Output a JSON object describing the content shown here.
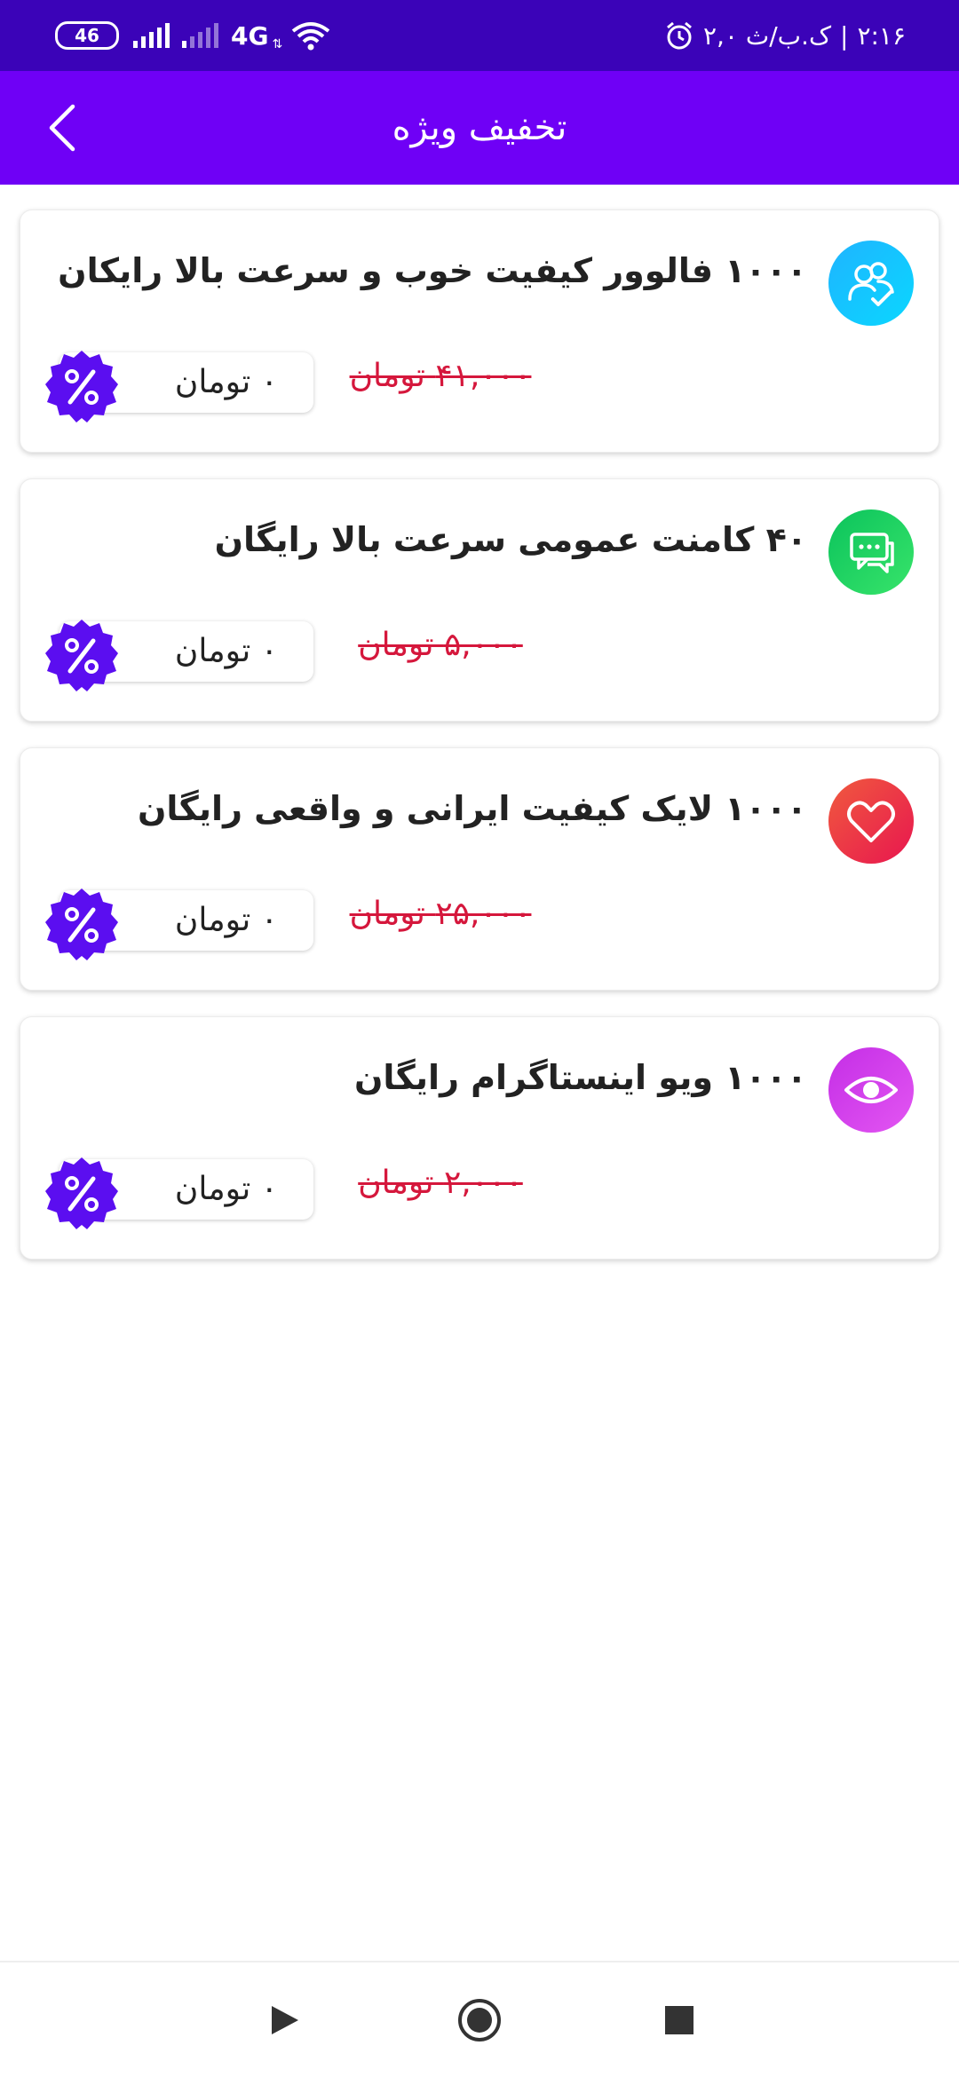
{
  "status_bar": {
    "time": "۲:۱۶",
    "date": "ک.ب/ث ۲,۰",
    "battery": "46",
    "network": "4G"
  },
  "app_bar": {
    "title": "تخفیف ویژه",
    "back_icon": "chevron-left-icon"
  },
  "offers": [
    {
      "title": "۱۰۰۰ فالوور کیفیت خوب و سرعت بالا رایکان",
      "old_price": "۴۱,۰۰۰ تومان",
      "price": "۰ تومان",
      "icon": "followers-icon",
      "colors": [
        "#1fb4ff",
        "#0ad7ff"
      ]
    },
    {
      "title": "۴۰ کامنت عمومی سرعت بالا رایگان",
      "old_price": "۵,۰۰۰ تومان",
      "price": "۰ تومان",
      "icon": "comment-icon",
      "colors": [
        "#0bc35c",
        "#38e46a"
      ]
    },
    {
      "title": "۱۰۰۰ لایک کیفیت ایرانی و واقعی رایگان",
      "old_price": "۲۵,۰۰۰ تومان",
      "price": "۰ تومان",
      "icon": "heart-icon",
      "colors": [
        "#f05a3e",
        "#e8164f"
      ]
    },
    {
      "title": "۱۰۰۰ ویو اینستاگرام رایگان",
      "old_price": "۲,۰۰۰ تومان",
      "price": "۰ تومان",
      "icon": "eye-icon",
      "colors": [
        "#c42ee6",
        "#e356f2"
      ]
    }
  ],
  "theme": {
    "primary": "#6f00f6",
    "status_bar": "#3b03b8",
    "badge": "#5b0ef0",
    "strike_price": "#d5173c"
  },
  "nav": {
    "back_icon": "triangle-back-icon",
    "home_icon": "circle-home-icon",
    "recents_icon": "square-recents-icon"
  }
}
